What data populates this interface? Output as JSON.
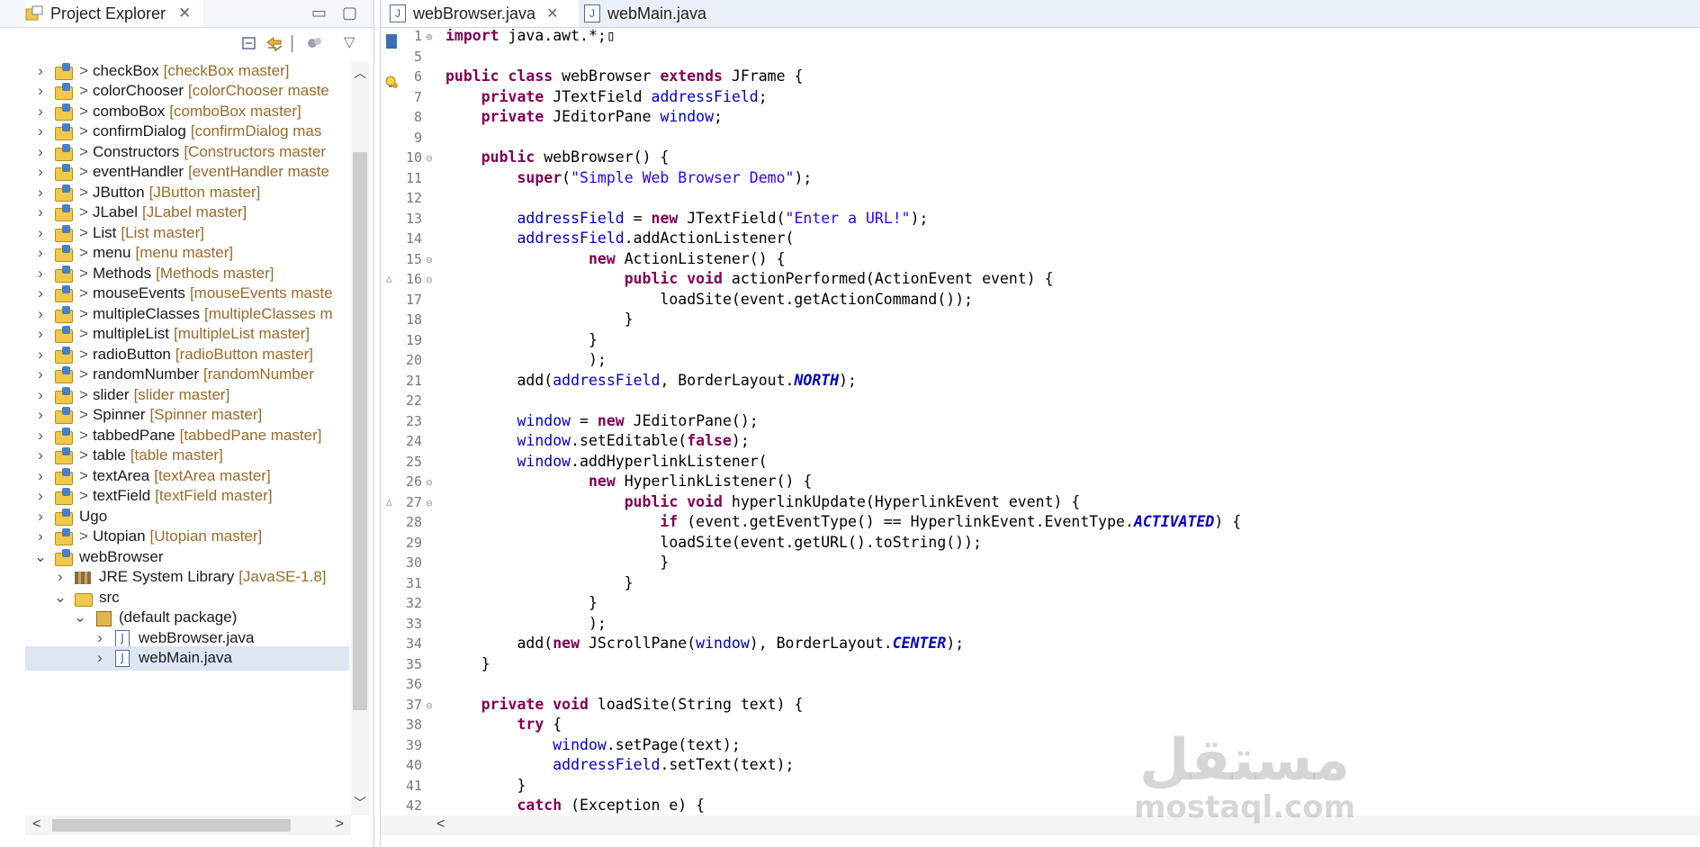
{
  "explorer": {
    "title": "Project Explorer",
    "close_glyph": "✕",
    "min_glyph": "▭",
    "max_glyph": "▢",
    "toolbar_icons": [
      "collapse-all-icon",
      "link-editor-icon",
      "filters-icon",
      "view-menu-icon"
    ],
    "tree": [
      {
        "kind": "proj",
        "depth": 0,
        "expanded": false,
        "gt": ">",
        "name": "checkBox",
        "branch": "[checkBox master]"
      },
      {
        "kind": "proj",
        "depth": 0,
        "expanded": false,
        "gt": ">",
        "name": "colorChooser",
        "branch": "[colorChooser maste"
      },
      {
        "kind": "proj",
        "depth": 0,
        "expanded": false,
        "gt": ">",
        "name": "comboBox",
        "branch": "[comboBox master]"
      },
      {
        "kind": "proj",
        "depth": 0,
        "expanded": false,
        "gt": ">",
        "name": "confirmDialog",
        "branch": "[confirmDialog mas"
      },
      {
        "kind": "proj",
        "depth": 0,
        "expanded": false,
        "gt": ">",
        "name": "Constructors",
        "branch": "[Constructors master"
      },
      {
        "kind": "proj",
        "depth": 0,
        "expanded": false,
        "gt": ">",
        "name": "eventHandler",
        "branch": "[eventHandler maste"
      },
      {
        "kind": "proj",
        "depth": 0,
        "expanded": false,
        "gt": ">",
        "name": "JButton",
        "branch": "[JButton master]"
      },
      {
        "kind": "proj",
        "depth": 0,
        "expanded": false,
        "gt": ">",
        "name": "JLabel",
        "branch": "[JLabel master]"
      },
      {
        "kind": "proj",
        "depth": 0,
        "expanded": false,
        "gt": ">",
        "name": "List",
        "branch": "[List master]"
      },
      {
        "kind": "proj",
        "depth": 0,
        "expanded": false,
        "gt": ">",
        "name": "menu",
        "branch": "[menu master]"
      },
      {
        "kind": "proj",
        "depth": 0,
        "expanded": false,
        "gt": ">",
        "name": "Methods",
        "branch": "[Methods master]"
      },
      {
        "kind": "proj",
        "depth": 0,
        "expanded": false,
        "gt": ">",
        "name": "mouseEvents",
        "branch": "[mouseEvents maste"
      },
      {
        "kind": "proj",
        "depth": 0,
        "expanded": false,
        "gt": ">",
        "name": "multipleClasses",
        "branch": "[multipleClasses m"
      },
      {
        "kind": "proj",
        "depth": 0,
        "expanded": false,
        "gt": ">",
        "name": "multipleList",
        "branch": "[multipleList master]"
      },
      {
        "kind": "proj",
        "depth": 0,
        "expanded": false,
        "gt": ">",
        "name": "radioButton",
        "branch": "[radioButton master]"
      },
      {
        "kind": "proj",
        "depth": 0,
        "expanded": false,
        "gt": ">",
        "name": "randomNumber",
        "branch": "[randomNumber"
      },
      {
        "kind": "proj",
        "depth": 0,
        "expanded": false,
        "gt": ">",
        "name": "slider",
        "branch": "[slider master]"
      },
      {
        "kind": "proj",
        "depth": 0,
        "expanded": false,
        "gt": ">",
        "name": "Spinner",
        "branch": "[Spinner master]"
      },
      {
        "kind": "proj",
        "depth": 0,
        "expanded": false,
        "gt": ">",
        "name": "tabbedPane",
        "branch": "[tabbedPane master]"
      },
      {
        "kind": "proj",
        "depth": 0,
        "expanded": false,
        "gt": ">",
        "name": "table",
        "branch": "[table master]"
      },
      {
        "kind": "proj",
        "depth": 0,
        "expanded": false,
        "gt": ">",
        "name": "textArea",
        "branch": "[textArea master]"
      },
      {
        "kind": "proj",
        "depth": 0,
        "expanded": false,
        "gt": ">",
        "name": "textField",
        "branch": "[textField master]"
      },
      {
        "kind": "proj",
        "depth": 0,
        "expanded": false,
        "gt": "",
        "name": "Ugo",
        "branch": ""
      },
      {
        "kind": "proj",
        "depth": 0,
        "expanded": false,
        "gt": ">",
        "name": "Utopian",
        "branch": "[Utopian master]"
      },
      {
        "kind": "proj",
        "depth": 0,
        "expanded": true,
        "gt": "",
        "name": "webBrowser",
        "branch": ""
      },
      {
        "kind": "lib",
        "depth": 1,
        "expanded": false,
        "gt": "",
        "name": "JRE System Library",
        "branch": "[JavaSE-1.8]"
      },
      {
        "kind": "src",
        "depth": 1,
        "expanded": true,
        "gt": "",
        "name": "src",
        "branch": ""
      },
      {
        "kind": "pkg",
        "depth": 2,
        "expanded": true,
        "gt": "",
        "name": "(default package)",
        "branch": ""
      },
      {
        "kind": "file",
        "depth": 3,
        "expanded": false,
        "gt": "",
        "name": "webBrowser.java",
        "branch": ""
      },
      {
        "kind": "file",
        "depth": 3,
        "expanded": false,
        "gt": "",
        "name": "webMain.java",
        "branch": "",
        "selected": true
      }
    ]
  },
  "editor": {
    "tabs": [
      {
        "label": "webBrowser.java",
        "active": true,
        "close_glyph": "✕"
      },
      {
        "label": "webMain.java",
        "active": false
      }
    ],
    "lines": [
      {
        "n": "1",
        "fold": "⊕",
        "code": [
          [
            "kw",
            "import"
          ],
          [
            "t",
            " java.awt.*;"
          ],
          [
            "t",
            "▯"
          ]
        ]
      },
      {
        "n": "5",
        "fold": "",
        "code": []
      },
      {
        "n": "6",
        "fold": "",
        "code": [
          [
            "kw",
            "public"
          ],
          [
            "t",
            " "
          ],
          [
            "kw",
            "class"
          ],
          [
            "t",
            " webBrowser "
          ],
          [
            "kw",
            "extends"
          ],
          [
            "t",
            " JFrame {"
          ]
        ]
      },
      {
        "n": "7",
        "fold": "",
        "code": [
          [
            "t",
            "    "
          ],
          [
            "kw",
            "private"
          ],
          [
            "t",
            " JTextField "
          ],
          [
            "fld",
            "addressField"
          ],
          [
            "t",
            ";"
          ]
        ]
      },
      {
        "n": "8",
        "fold": "",
        "code": [
          [
            "t",
            "    "
          ],
          [
            "kw",
            "private"
          ],
          [
            "t",
            " JEditorPane "
          ],
          [
            "fld",
            "window"
          ],
          [
            "t",
            ";"
          ]
        ]
      },
      {
        "n": "9",
        "fold": "",
        "code": []
      },
      {
        "n": "10",
        "fold": "⊖",
        "code": [
          [
            "t",
            "    "
          ],
          [
            "kw",
            "public"
          ],
          [
            "t",
            " webBrowser() {"
          ]
        ]
      },
      {
        "n": "11",
        "fold": "",
        "code": [
          [
            "t",
            "        "
          ],
          [
            "kw",
            "super"
          ],
          [
            "t",
            "("
          ],
          [
            "str",
            "\"Simple Web Browser Demo\""
          ],
          [
            "t",
            ");"
          ]
        ]
      },
      {
        "n": "12",
        "fold": "",
        "code": []
      },
      {
        "n": "13",
        "fold": "",
        "code": [
          [
            "t",
            "        "
          ],
          [
            "fld",
            "addressField"
          ],
          [
            "t",
            " = "
          ],
          [
            "kw",
            "new"
          ],
          [
            "t",
            " JTextField("
          ],
          [
            "str",
            "\"Enter a URL!\""
          ],
          [
            "t",
            ");"
          ]
        ]
      },
      {
        "n": "14",
        "fold": "",
        "code": [
          [
            "t",
            "        "
          ],
          [
            "fld",
            "addressField"
          ],
          [
            "t",
            ".addActionListener("
          ]
        ]
      },
      {
        "n": "15",
        "fold": "⊖",
        "code": [
          [
            "t",
            "                "
          ],
          [
            "kw",
            "new"
          ],
          [
            "t",
            " ActionListener() {"
          ]
        ]
      },
      {
        "n": "16",
        "fold": "⊖",
        "warn": "△",
        "code": [
          [
            "t",
            "                    "
          ],
          [
            "kw",
            "public"
          ],
          [
            "t",
            " "
          ],
          [
            "kw",
            "void"
          ],
          [
            "t",
            " actionPerformed(ActionEvent event) {"
          ]
        ]
      },
      {
        "n": "17",
        "fold": "",
        "code": [
          [
            "t",
            "                        loadSite(event.getActionCommand());"
          ]
        ]
      },
      {
        "n": "18",
        "fold": "",
        "code": [
          [
            "t",
            "                    }"
          ]
        ]
      },
      {
        "n": "19",
        "fold": "",
        "code": [
          [
            "t",
            "                }"
          ]
        ]
      },
      {
        "n": "20",
        "fold": "",
        "code": [
          [
            "t",
            "                );"
          ]
        ]
      },
      {
        "n": "21",
        "fold": "",
        "code": [
          [
            "t",
            "        add("
          ],
          [
            "fld",
            "addressField"
          ],
          [
            "t",
            ", BorderLayout."
          ],
          [
            "cst",
            "NORTH"
          ],
          [
            "t",
            ");"
          ]
        ]
      },
      {
        "n": "22",
        "fold": "",
        "code": []
      },
      {
        "n": "23",
        "fold": "",
        "code": [
          [
            "t",
            "        "
          ],
          [
            "fld",
            "window"
          ],
          [
            "t",
            " = "
          ],
          [
            "kw",
            "new"
          ],
          [
            "t",
            " JEditorPane();"
          ]
        ]
      },
      {
        "n": "24",
        "fold": "",
        "code": [
          [
            "t",
            "        "
          ],
          [
            "fld",
            "window"
          ],
          [
            "t",
            ".setEditable("
          ],
          [
            "kw",
            "false"
          ],
          [
            "t",
            ");"
          ]
        ]
      },
      {
        "n": "25",
        "fold": "",
        "code": [
          [
            "t",
            "        "
          ],
          [
            "fld",
            "window"
          ],
          [
            "t",
            ".addHyperlinkListener("
          ]
        ]
      },
      {
        "n": "26",
        "fold": "⊖",
        "code": [
          [
            "t",
            "                "
          ],
          [
            "kw",
            "new"
          ],
          [
            "t",
            " HyperlinkListener() {"
          ]
        ]
      },
      {
        "n": "27",
        "fold": "⊖",
        "warn": "△",
        "code": [
          [
            "t",
            "                    "
          ],
          [
            "kw",
            "public"
          ],
          [
            "t",
            " "
          ],
          [
            "kw",
            "void"
          ],
          [
            "t",
            " hyperlinkUpdate(HyperlinkEvent event) {"
          ]
        ]
      },
      {
        "n": "28",
        "fold": "",
        "code": [
          [
            "t",
            "                        "
          ],
          [
            "kw",
            "if"
          ],
          [
            "t",
            " (event.getEventType() == HyperlinkEvent.EventType."
          ],
          [
            "cst",
            "ACTIVATED"
          ],
          [
            "t",
            ") {"
          ]
        ]
      },
      {
        "n": "29",
        "fold": "",
        "code": [
          [
            "t",
            "                        loadSite(event.getURL().toString());"
          ]
        ]
      },
      {
        "n": "30",
        "fold": "",
        "code": [
          [
            "t",
            "                        }"
          ]
        ]
      },
      {
        "n": "31",
        "fold": "",
        "code": [
          [
            "t",
            "                    }"
          ]
        ]
      },
      {
        "n": "32",
        "fold": "",
        "code": [
          [
            "t",
            "                }"
          ]
        ]
      },
      {
        "n": "33",
        "fold": "",
        "code": [
          [
            "t",
            "                );"
          ]
        ]
      },
      {
        "n": "34",
        "fold": "",
        "code": [
          [
            "t",
            "        add("
          ],
          [
            "kw",
            "new"
          ],
          [
            "t",
            " JScrollPane("
          ],
          [
            "fld",
            "window"
          ],
          [
            "t",
            "), BorderLayout."
          ],
          [
            "cst",
            "CENTER"
          ],
          [
            "t",
            ");"
          ]
        ]
      },
      {
        "n": "35",
        "fold": "",
        "code": [
          [
            "t",
            "    }"
          ]
        ]
      },
      {
        "n": "36",
        "fold": "",
        "code": []
      },
      {
        "n": "37",
        "fold": "⊖",
        "code": [
          [
            "t",
            "    "
          ],
          [
            "kw",
            "private"
          ],
          [
            "t",
            " "
          ],
          [
            "kw",
            "void"
          ],
          [
            "t",
            " loadSite(String text) {"
          ]
        ]
      },
      {
        "n": "38",
        "fold": "",
        "code": [
          [
            "t",
            "        "
          ],
          [
            "kw",
            "try"
          ],
          [
            "t",
            " {"
          ]
        ]
      },
      {
        "n": "39",
        "fold": "",
        "code": [
          [
            "t",
            "            "
          ],
          [
            "fld",
            "window"
          ],
          [
            "t",
            ".setPage(text);"
          ]
        ]
      },
      {
        "n": "40",
        "fold": "",
        "code": [
          [
            "t",
            "            "
          ],
          [
            "fld",
            "addressField"
          ],
          [
            "t",
            ".setText(text);"
          ]
        ]
      },
      {
        "n": "41",
        "fold": "",
        "code": [
          [
            "t",
            "        }"
          ]
        ]
      },
      {
        "n": "42",
        "fold": "",
        "code": [
          [
            "t",
            "        "
          ],
          [
            "kw",
            "catch"
          ],
          [
            "t",
            " (Exception e) {"
          ]
        ]
      }
    ]
  },
  "watermark": {
    "arabic": "مستقل",
    "latin": "mostaql.com"
  },
  "colors": {
    "keyword": "#7f0055",
    "field": "#0000c0",
    "string": "#2a00ff",
    "branch": "#9a6a28",
    "selection": "#dde6f3"
  }
}
